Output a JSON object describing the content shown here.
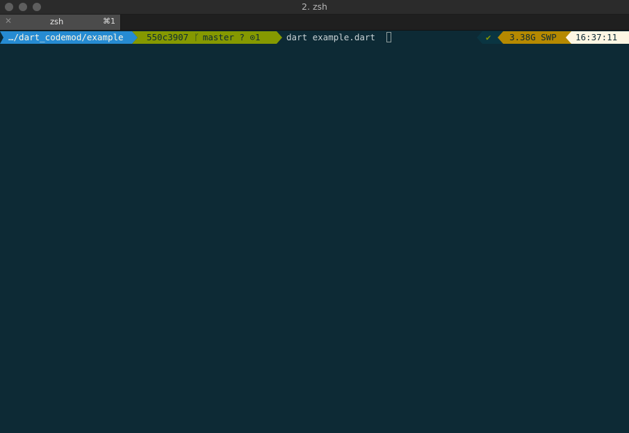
{
  "window": {
    "title": "2. zsh"
  },
  "tab": {
    "close_glyph": "✕",
    "label": "zsh",
    "shortcut": "⌘1"
  },
  "prompt": {
    "directory": "…/dart_codemod/example",
    "commit": "550c3907",
    "branch_icon": "git-branch-icon",
    "branch_glyph": "ᚴ",
    "branch": "master",
    "untracked": "?",
    "stash": "⊙1",
    "command": "dart example.dart",
    "status_glyph": "✔",
    "swap": "3.38G SWP",
    "time": "16:37:11"
  },
  "colors": {
    "background": "#0d2a35",
    "dir_segment": "#268bd2",
    "git_segment": "#859900",
    "swap_segment": "#b58900",
    "time_segment": "#fdf6e3"
  }
}
